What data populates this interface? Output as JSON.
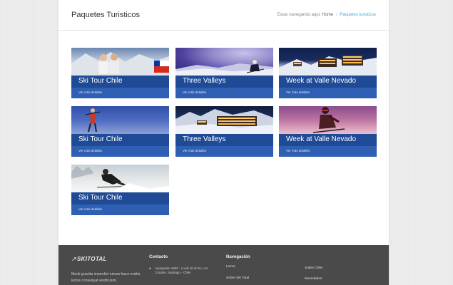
{
  "header": {
    "title": "Paquetes Turisticos",
    "breadcrumb_prefix": "Estas navegando aqui:",
    "breadcrumb_home": "Home",
    "breadcrumb_separator": "/",
    "breadcrumb_current": "Paquetes turisticos"
  },
  "packages": [
    {
      "title": "Ski Tour Chile",
      "link": "Ver más detalles"
    },
    {
      "title": "Three Valleys",
      "link": "Ver más detalles"
    },
    {
      "title": "Week at Valle Nevado",
      "link": "Ver más detalles"
    },
    {
      "title": "Ski Tour Chile",
      "link": "Ver más detalles"
    },
    {
      "title": "Three Valleys",
      "link": "Ver más detalles"
    },
    {
      "title": "Week at Valle Nevado",
      "link": "Ver más detalles"
    },
    {
      "title": "Ski Tour Chile",
      "link": "Ver más detalles"
    }
  ],
  "footer": {
    "logo": "SKITOTAL",
    "about": "Morbi gravida imperdiet rutrum fusce mattis, lectus consequat vestibulum,",
    "contact_heading": "Contacto",
    "address": "Apoquindo 4900 · Local 40 al 46, Las Condes, Santiago - Chile",
    "nav_heading": "Navegación",
    "nav_links": [
      "Home",
      "Sobre Ski Total",
      "Sobre Chile",
      "Novedades"
    ]
  },
  "colors": {
    "card_blue": "#2f5fb3",
    "card_title_band": "#1f4a96",
    "breadcrumb_active": "#4aa8d8",
    "footer_bg": "#4a4a4a"
  }
}
